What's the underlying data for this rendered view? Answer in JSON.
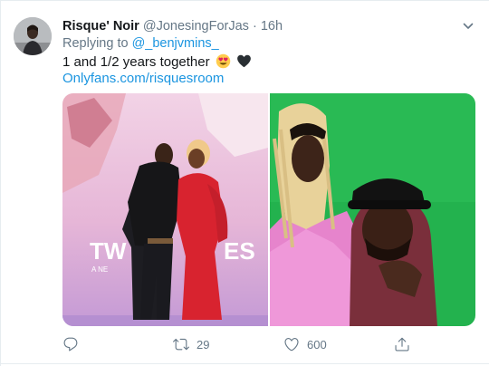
{
  "tweet": {
    "display_name": "Risque' Noir",
    "handle": "@JonesingForJas",
    "separator": "·",
    "time": "16h",
    "replying_prefix": "Replying to",
    "replying_to": "@_benjvmins_",
    "text": "1 and 1/2 years together",
    "emojis": [
      "heart-eyes-emoji",
      "black-heart-emoji"
    ],
    "link": "Onlyfans.com/risquesroom",
    "media": {
      "left_photo_sign_text": "TW",
      "left_photo_sign_text_2": "ES",
      "left_photo_sign_subtext": "A NE"
    },
    "actions": {
      "reply_icon": "reply-icon",
      "retweet_icon": "retweet-icon",
      "retweet_count": "29",
      "like_icon": "heart-icon",
      "like_count": "600",
      "share_icon": "share-icon"
    }
  },
  "colors": {
    "link": "#1b95e0",
    "muted": "#657786",
    "text": "#14171a",
    "border": "#e6ecf0"
  }
}
